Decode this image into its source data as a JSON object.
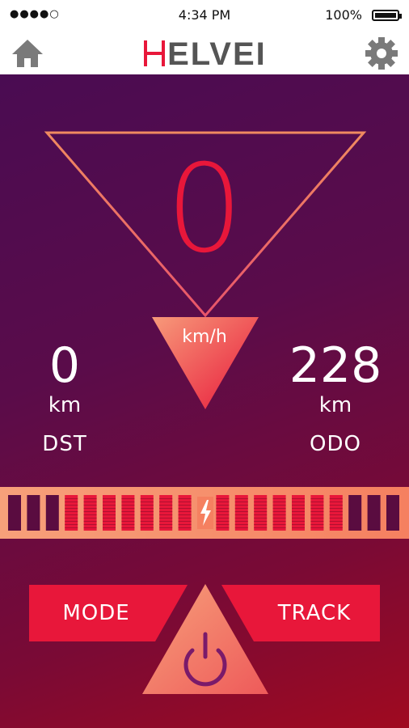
{
  "status_bar": {
    "signal": "●●●●○",
    "time": "4:34 PM",
    "battery_percent": "100%"
  },
  "nav": {
    "logo_text": "HELVEI",
    "home_icon": "home-icon",
    "settings_icon": "gear-icon"
  },
  "speedometer": {
    "speed": "0",
    "unit": "km/h"
  },
  "stats": {
    "distance": {
      "value": "0",
      "unit": "km",
      "label": "DST"
    },
    "odometer": {
      "value": "228",
      "unit": "km",
      "label": "ODO"
    }
  },
  "battery_gauge": {
    "icon": "lightning-icon"
  },
  "buttons": {
    "mode": "MODE",
    "track": "TRACK",
    "power_icon": "power-icon"
  },
  "colors": {
    "accent": "#e8173a",
    "bg_top": "#4a0c52",
    "bg_bottom": "#a00a20",
    "outline": "#f07a5a"
  }
}
